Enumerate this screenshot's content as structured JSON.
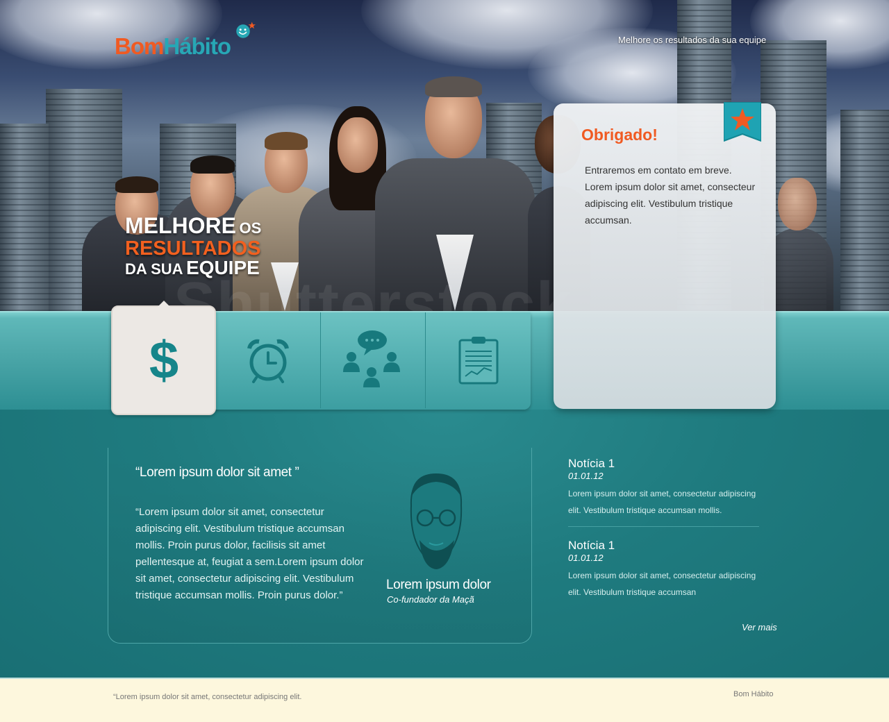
{
  "brand": {
    "name_part1": "Bom",
    "name_part2": "Hábito",
    "accent_orange": "#f05a22",
    "accent_teal": "#27a7b5"
  },
  "header": {
    "tagline": "Melhore os resultados da sua equipe"
  },
  "hero": {
    "headline_line1_big": "MELHORE",
    "headline_line1_small": "OS",
    "headline_line2": "RESULTADOS",
    "headline_line3_small": "DA SUA",
    "headline_line3_big": "EQUIPE",
    "watermark": "Shutterstock"
  },
  "tabs": [
    {
      "icon": "dollar-icon",
      "active": true
    },
    {
      "icon": "alarm-clock-icon",
      "active": false
    },
    {
      "icon": "team-chat-icon",
      "active": false
    },
    {
      "icon": "clipboard-chart-icon",
      "active": false
    }
  ],
  "thanks_card": {
    "title": "Obrigado!",
    "body": "Entraremos em contato em breve. Lorem ipsum dolor sit amet, consecteur adipiscing elit. Vestibulum tristique accumsan.",
    "ribbon_icon": "star-ribbon-icon"
  },
  "testimonial": {
    "title": "“Lorem ipsum dolor sit amet ”",
    "body": "“Lorem ipsum dolor sit amet, consectetur adipiscing elit. Vestibulum tristique accumsan mollis. Proin purus dolor, facilisis sit amet pellentesque at, feugiat a sem.Lorem ipsum dolor sit amet, consectetur adipiscing elit. Vestibulum tristique accumsan mollis. Proin purus dolor.”",
    "person_name": "Lorem ipsum dolor",
    "person_role": "Co-fundador da Maçã"
  },
  "news": [
    {
      "title": "Notícia 1",
      "date": "01.01.12",
      "body": "Lorem ipsum dolor sit amet, consectetur adipiscing elit. Vestibulum tristique accumsan mollis."
    },
    {
      "title": "Notícia 1",
      "date": "01.01.12",
      "body": "Lorem ipsum dolor sit amet, consectetur adipiscing elit. Vestibulum tristique accumsan"
    }
  ],
  "news_more": "Ver mais",
  "footer": {
    "quote": "“Lorem ipsum dolor sit amet, consectetur adipiscing elit.",
    "brand": "Bom Hábito"
  }
}
